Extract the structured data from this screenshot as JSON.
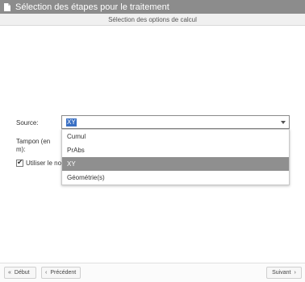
{
  "titlebar": {
    "title": "Sélection des étapes pour le traitement",
    "icon": "document-icon"
  },
  "subheader": {
    "text": "Sélection des options de calcul"
  },
  "form": {
    "source_label": "Source:",
    "source_value": "XY",
    "tampon_label_line1": "Tampon (en",
    "tampon_label_line2": "m):",
    "checkbox_label": "Utiliser le no",
    "checkbox_checked": true
  },
  "dropdown": {
    "options": [
      "Cumul",
      "PrAbs",
      "XY",
      "Géométrie(s)"
    ],
    "selected": "XY"
  },
  "footer": {
    "debut_label": "Début",
    "precedent_label": "Précédent",
    "suivant_label": "Suivant"
  },
  "colors": {
    "titlebar": "#8c8c8c",
    "selection": "#3a70c4",
    "highlight": "#8f8f8f"
  }
}
